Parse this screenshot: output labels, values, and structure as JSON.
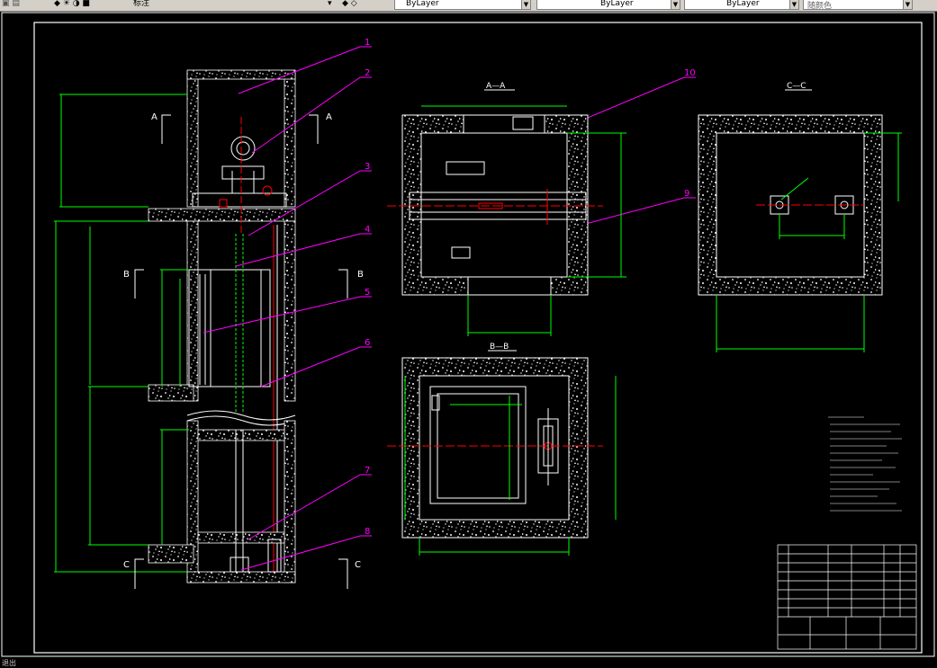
{
  "toolbar": {
    "layer_name": "标注",
    "color_value": "ByLayer",
    "linetype_value": "ByLayer",
    "lineweight_value": "ByLayer",
    "plotstyle_value": "随颜色"
  },
  "status": {
    "prompt": "退出"
  },
  "drawing": {
    "views": {
      "aa": "A—A",
      "bb": "B—B",
      "cc": "C—C"
    },
    "section_marks": {
      "a": "A",
      "b": "B",
      "c": "C"
    },
    "callouts": [
      "1",
      "2",
      "3",
      "4",
      "5",
      "6",
      "7",
      "8",
      "9",
      "10"
    ],
    "colors": {
      "frame": "#ffffff",
      "dimension": "#00ff00",
      "leader": "#ff00ff",
      "centerline": "#ff0000",
      "accent": "#ffff00"
    }
  }
}
